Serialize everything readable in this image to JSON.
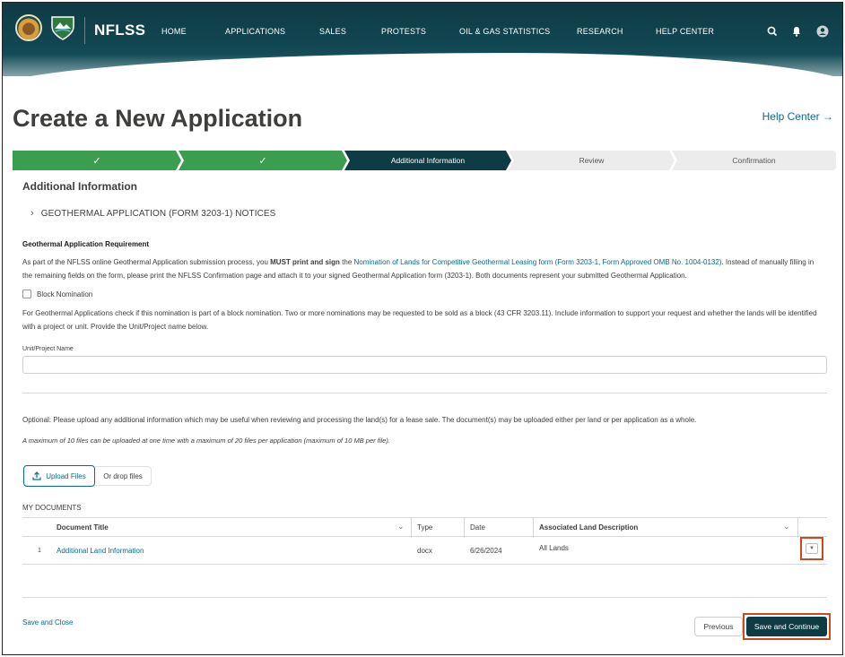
{
  "header": {
    "brand": "NFLSS",
    "nav": [
      "HOME",
      "APPLICATIONS",
      "SALES",
      "PROTESTS",
      "OIL & GAS STATISTICS",
      "RESEARCH",
      "HELP CENTER"
    ],
    "icons": [
      "search-icon",
      "bell-icon",
      "user-avatar-icon"
    ]
  },
  "page": {
    "title": "Create a New Application",
    "help_link": "Help Center →"
  },
  "progress": {
    "steps": [
      {
        "label": "✓",
        "state": "complete"
      },
      {
        "label": "✓",
        "state": "complete"
      },
      {
        "label": "Additional Information",
        "state": "current"
      },
      {
        "label": "Review",
        "state": "upcoming"
      },
      {
        "label": "Confirmation",
        "state": "upcoming"
      }
    ]
  },
  "form": {
    "section_title": "Additional Information",
    "accordion_label": "GEOTHERMAL APPLICATION (FORM 3203-1) NOTICES",
    "requirement_heading": "Geothermal Application Requirement",
    "req_p1_a": "As part of the NFLSS online Geothermal Application submission process, you ",
    "req_p1_bold": "MUST print and sign",
    "req_p1_b": " the ",
    "req_p1_link": "Nomination of Lands for Competitive Geothermal Leasing form (Form 3203-1, Form Approved OMB No. 1004-0132)",
    "req_p1_c": ". Instead of manually filling in the remaining fields on the form, please print the NFLSS Confirmation page and attach it to your signed Geothermal Application form (3203-1). Both documents represent your submitted Geothermal Application.",
    "block_nomination_label": "Block Nomination",
    "block_nomination_checked": false,
    "block_help": "For Geothermal Applications check if this nomination is part of a block nomination. Two or more nominations may be requested to be sold as a block (43 CFR 3203.11). Include information to support your request and whether the lands will be identified with a project or unit. Provide the Unit/Project name below.",
    "unit_label": "Unit/Project Name",
    "unit_value": "",
    "optional_text": "Optional: Please upload any additional information which may be useful when reviewing and processing the land(s) for a lease sale. The document(s) may be uploaded either per land or per application as a whole.",
    "limit_text": "A maximum of 10 files can be uploaded at one time with a maximum of 20 files per application (maximum of 10 MB per file).",
    "upload_label": "Upload Files",
    "drop_label": "Or drop files",
    "my_documents": "MY DOCUMENTS"
  },
  "documents": {
    "columns": [
      "Document Title",
      "Type",
      "Date",
      "Associated Land Description"
    ],
    "rows": [
      {
        "num": "1",
        "title": "Additional Land Information",
        "type": "docx",
        "date": "6/26/2024",
        "land": "All Lands"
      }
    ]
  },
  "footer": {
    "save_close": "Save and Close",
    "previous": "Previous",
    "save_continue": "Save and Continue"
  },
  "colors": {
    "header": "#0f3b44",
    "step_complete": "#3a9d4f",
    "step_current": "#0f3b44",
    "step_upcoming": "#ececec",
    "link": "#0b6a8a",
    "highlight": "#c84a1f"
  }
}
